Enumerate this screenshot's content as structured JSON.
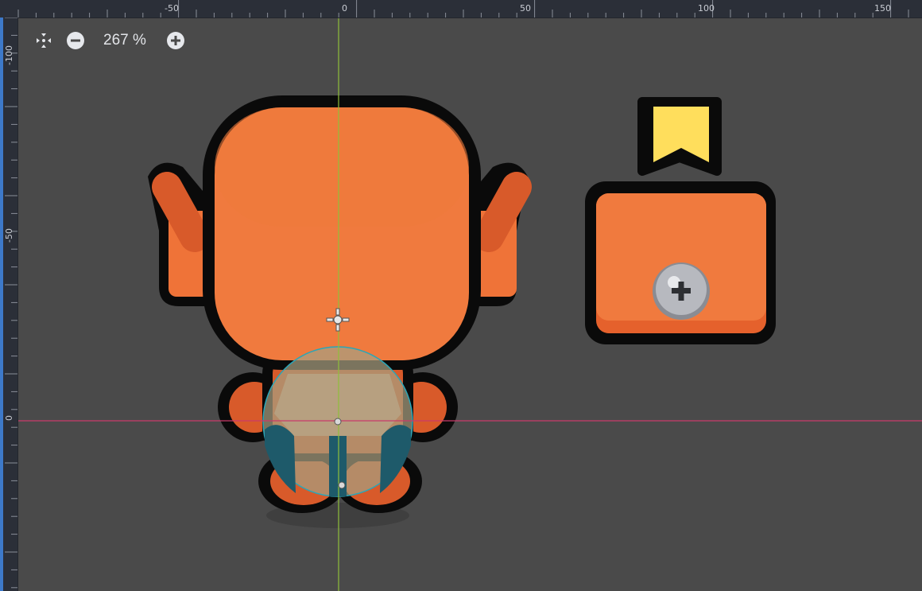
{
  "top_ruler": {
    "labels": [
      "-50",
      "0",
      "50",
      "100",
      "150"
    ]
  },
  "left_ruler": {
    "labels": [
      "-100",
      "-50",
      "0"
    ]
  },
  "toolbar": {
    "center_view_icon": "center-view-icon",
    "zoom_out_icon": "zoom-out-icon",
    "zoom_value": "267 %",
    "zoom_in_icon": "zoom-in-icon"
  },
  "colors": {
    "canvas_bg": "#4a4a4a",
    "ruler_bg": "#2b2f38",
    "ruler_accent": "#3d79c9",
    "robot_orange": "#f07a3e",
    "robot_dark_orange": "#d85a2a",
    "outline": "#0a0a0a",
    "flag_yellow": "#ffde5c",
    "collision_shape": "rgba(168,158,128,0.72)",
    "collision_teal": "#1e5a6a",
    "x_axis": "#c93a6a",
    "y_axis": "#8fbf3a"
  },
  "scene": {
    "character_name": "robot-sprite",
    "item_name": "crate-with-screw",
    "flag_name": "yellow-flag"
  }
}
